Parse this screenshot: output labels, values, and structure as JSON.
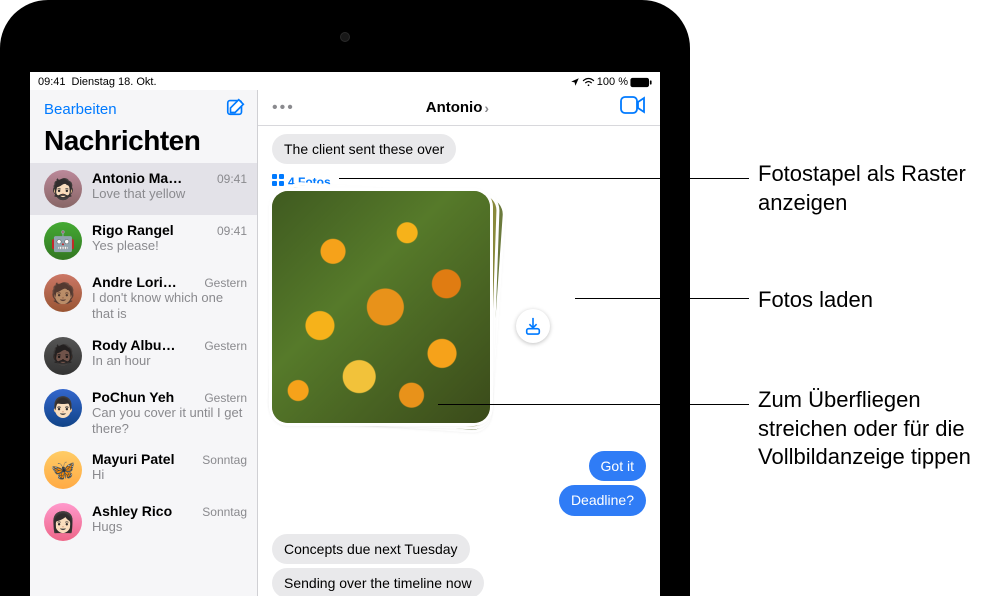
{
  "status": {
    "time": "09:41",
    "date": "Dienstag 18. Okt.",
    "battery_pct": "100 %"
  },
  "sidebar": {
    "edit": "Bearbeiten",
    "title": "Nachrichten",
    "items": [
      {
        "name": "Antonio Ma…",
        "time": "09:41",
        "preview": "Love that yellow"
      },
      {
        "name": "Rigo Rangel",
        "time": "09:41",
        "preview": "Yes please!"
      },
      {
        "name": "Andre Lori…",
        "time": "Gestern",
        "preview": "I don't know which one that is"
      },
      {
        "name": "Rody Albu…",
        "time": "Gestern",
        "preview": "In an hour"
      },
      {
        "name": "PoChun Yeh",
        "time": "Gestern",
        "preview": "Can you cover it until I get there?"
      },
      {
        "name": "Mayuri Patel",
        "time": "Sonntag",
        "preview": "Hi"
      },
      {
        "name": "Ashley Rico",
        "time": "Sonntag",
        "preview": "Hugs"
      }
    ]
  },
  "chat": {
    "title": "Antonio",
    "photo_stack_label": "4 Fotos",
    "messages": {
      "in1": "The client sent these over",
      "out1": "Got it",
      "out2": "Deadline?",
      "in2": "Concepts due next Tuesday",
      "in3": "Sending over the timeline now"
    }
  },
  "callouts": {
    "c1": "Fotostapel als Raster anzeigen",
    "c2": "Fotos laden",
    "c3": "Zum Überfliegen streichen oder für die Vollbildanzeige tippen"
  }
}
